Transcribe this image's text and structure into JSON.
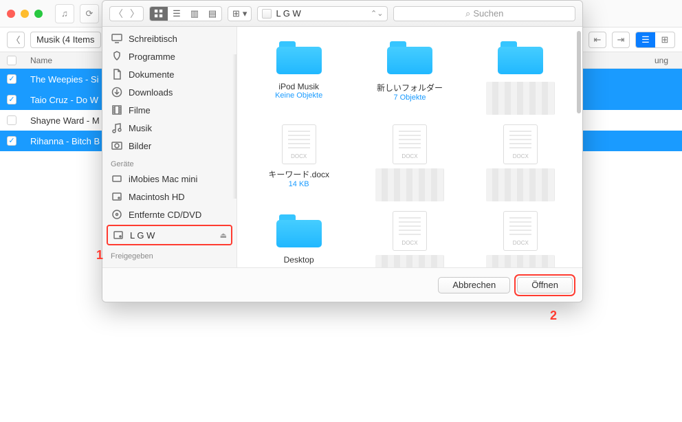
{
  "background": {
    "breadcrumb": "Musik (4 Items",
    "header_name": "Name",
    "header_time": "ung",
    "rows": [
      {
        "checked": true,
        "selected": true,
        "text": "The Weepies - Si"
      },
      {
        "checked": true,
        "selected": true,
        "text": "Taio Cruz - Do W"
      },
      {
        "checked": false,
        "selected": false,
        "text": "Shayne Ward - M"
      },
      {
        "checked": true,
        "selected": true,
        "text": "Rihanna - Bitch B"
      }
    ]
  },
  "dialog": {
    "path_label": "L G W",
    "search_placeholder": "Suchen",
    "sidebar": {
      "favorites": [
        {
          "icon": "desktop",
          "label": "Schreibtisch"
        },
        {
          "icon": "apps",
          "label": "Programme"
        },
        {
          "icon": "docs",
          "label": "Dokumente"
        },
        {
          "icon": "download",
          "label": "Downloads"
        },
        {
          "icon": "film",
          "label": "Filme"
        },
        {
          "icon": "music",
          "label": "Musik"
        },
        {
          "icon": "photo",
          "label": "Bilder"
        }
      ],
      "devices_label": "Geräte",
      "devices": [
        {
          "icon": "devhost",
          "label": "iMobies Mac mini"
        },
        {
          "icon": "hdd",
          "label": "Macintosh HD"
        },
        {
          "icon": "cd",
          "label": "Entfernte CD/DVD"
        }
      ],
      "devices_selected": {
        "icon": "hdd",
        "label": "L G W"
      },
      "shared_label": "Freigegeben"
    },
    "items": [
      {
        "kind": "folder",
        "name": "iPod Musik",
        "meta": "Keine Objekte",
        "metaClass": "fmeta"
      },
      {
        "kind": "folder",
        "name": "新しいフォルダー",
        "meta": "7 Objekte",
        "metaClass": "fmeta"
      },
      {
        "kind": "folder",
        "name": "",
        "meta": "",
        "metaClass": "fmeta",
        "blurred": true
      },
      {
        "kind": "docx",
        "name": "キーワード.docx",
        "meta": "14 KB",
        "metaClass": "fmeta"
      },
      {
        "kind": "docx",
        "name": "",
        "meta": "",
        "metaClass": "fmeta grey",
        "blurred": true
      },
      {
        "kind": "docx",
        "name": "",
        "meta": "",
        "metaClass": "fmeta grey",
        "blurred": true
      },
      {
        "kind": "folder",
        "name": "Desktop",
        "meta": "",
        "metaClass": "fmeta"
      },
      {
        "kind": "docx",
        "name": "",
        "meta": "",
        "metaClass": "fmeta grey",
        "blurred": true
      },
      {
        "kind": "docx",
        "name": "",
        "meta": "",
        "metaClass": "fmeta grey",
        "blurred": true
      }
    ],
    "cancel": "Abbrechen",
    "open": "Öffnen"
  },
  "annotations": {
    "one": "1",
    "two": "2"
  }
}
